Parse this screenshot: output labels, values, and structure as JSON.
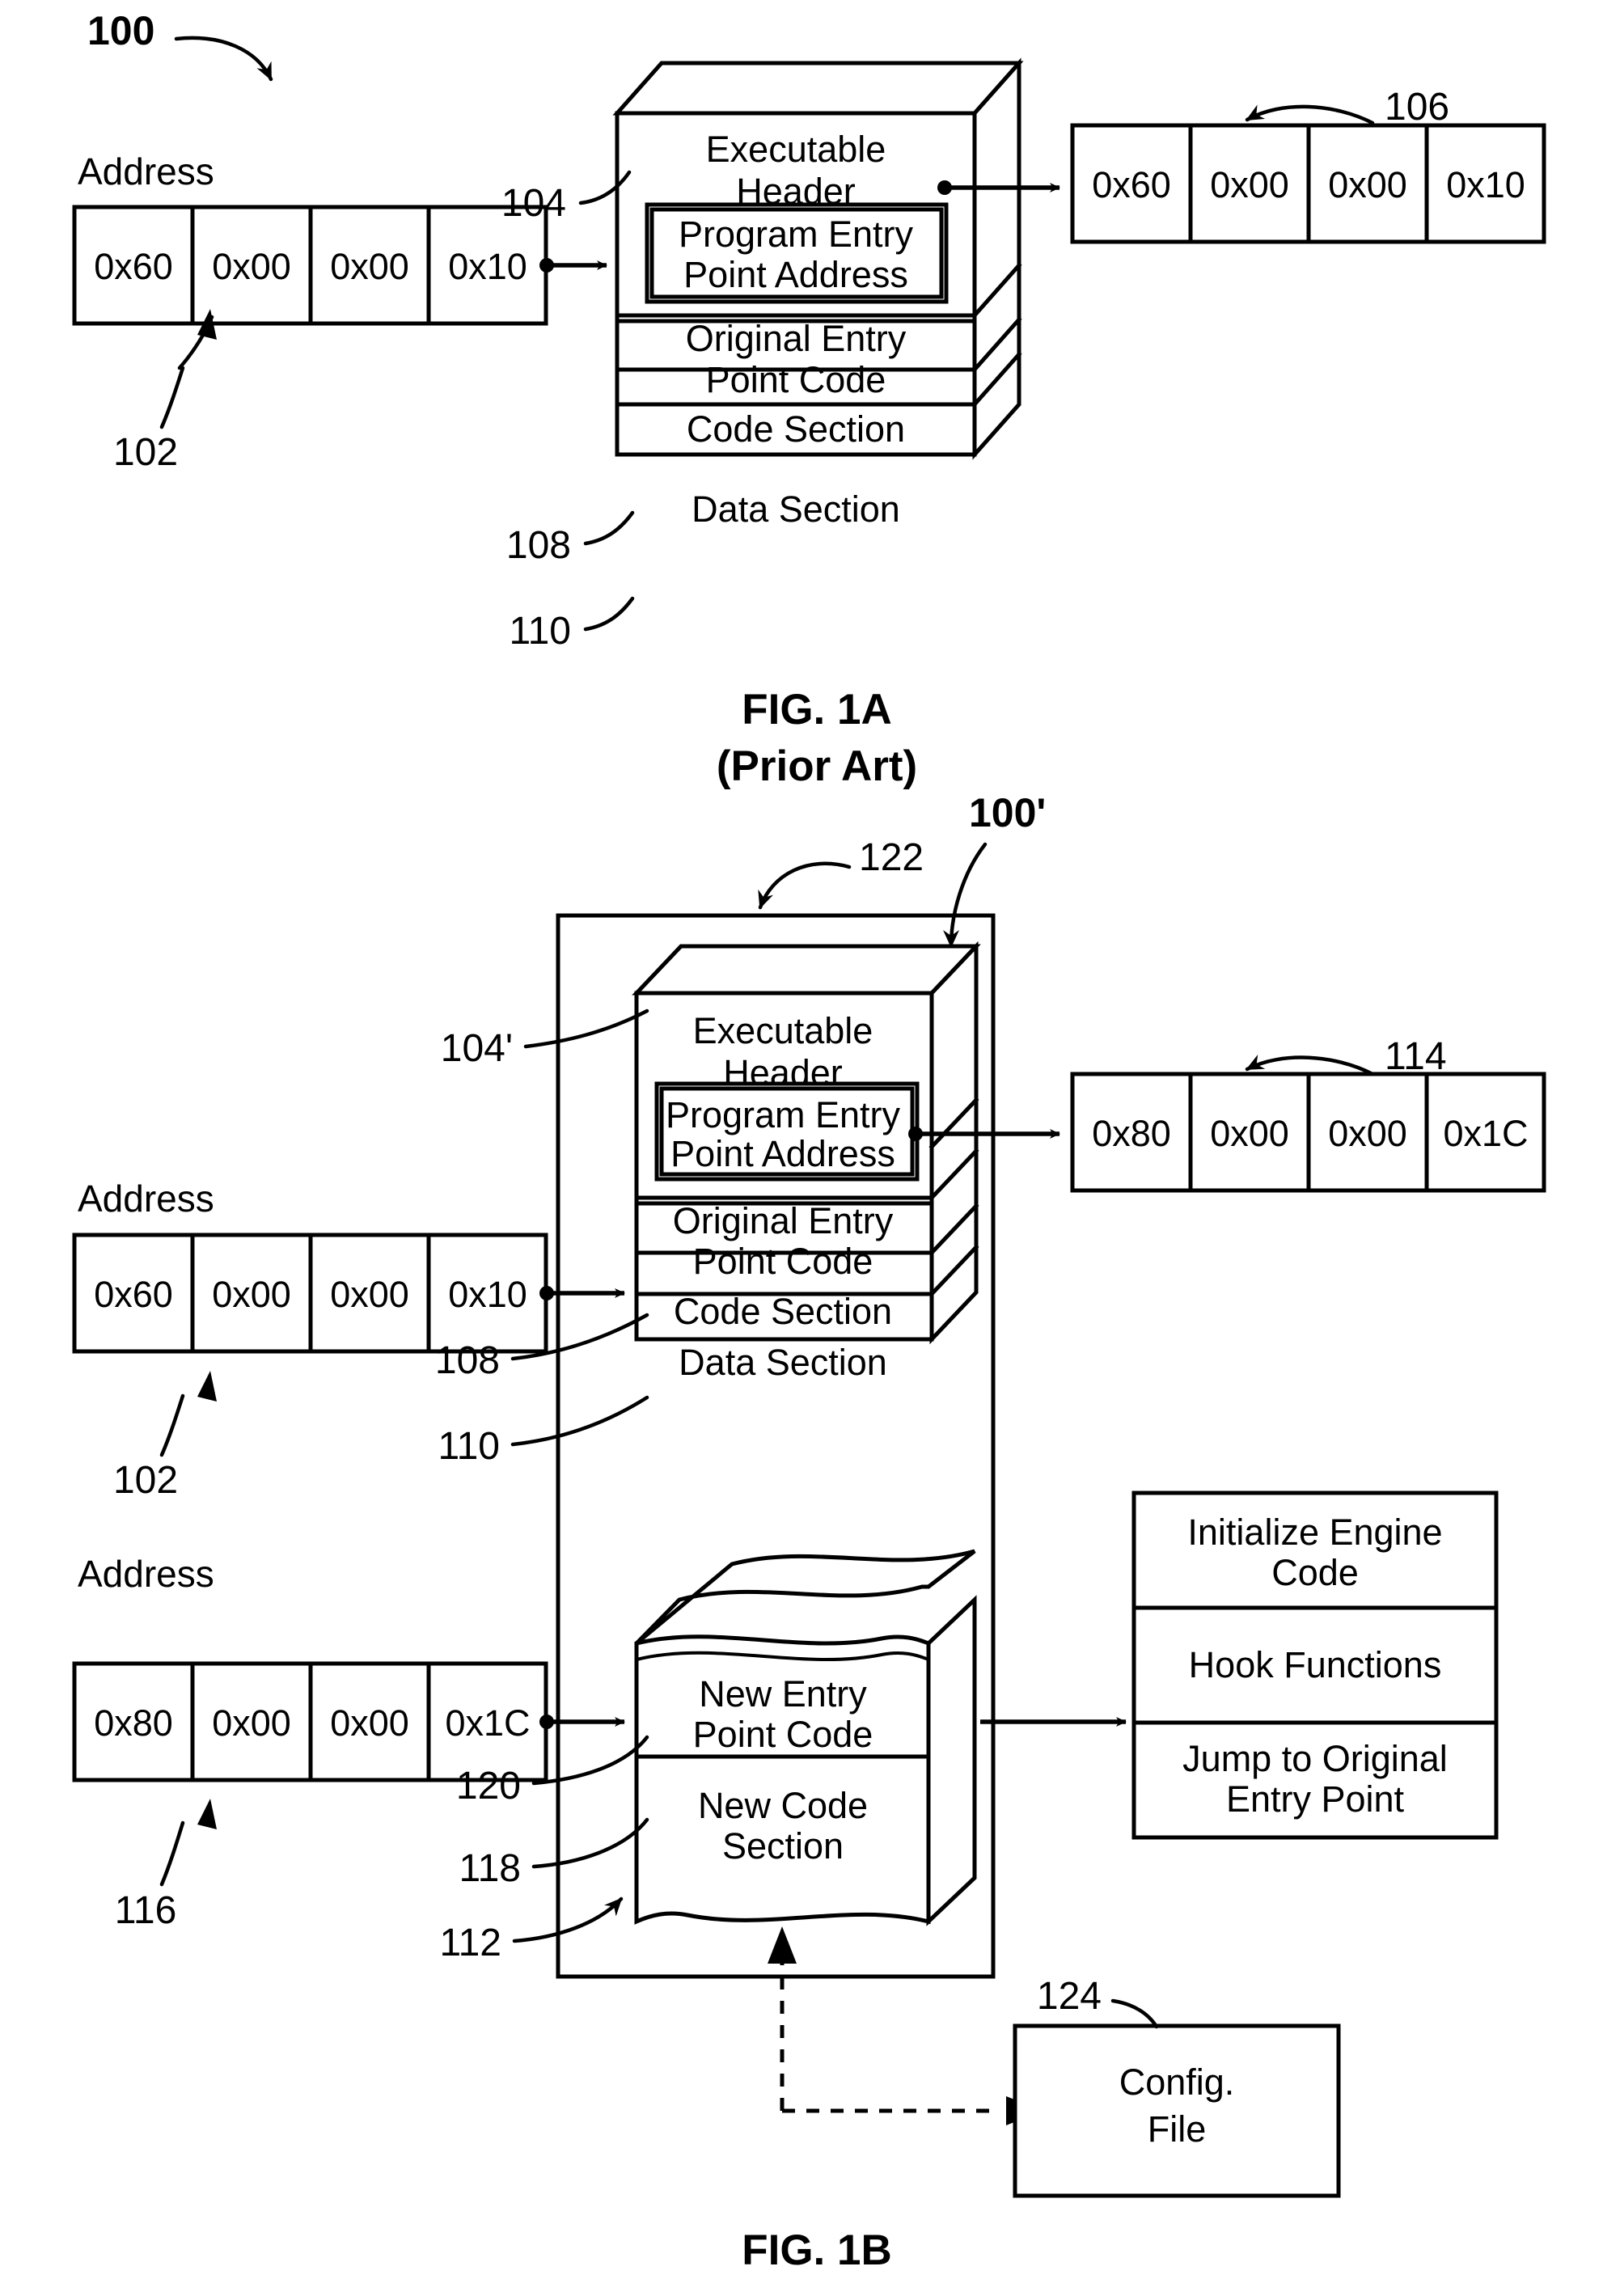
{
  "figures": [
    {
      "id": "fig-1a",
      "caption": "FIG. 1A",
      "subcaption": "(Prior Art)",
      "overall_ref": "100",
      "address_label": "Address",
      "address_table": {
        "ref": "102",
        "cells": [
          "0x60",
          "0x00",
          "0x00",
          "0x10"
        ]
      },
      "executable": {
        "ref": "104",
        "sections": [
          {
            "ref": "104",
            "label": "Executable Header"
          },
          {
            "ref": "",
            "label": "Program Entry Point Address"
          },
          {
            "ref": "",
            "label": "Original Entry Point Code"
          },
          {
            "ref": "108",
            "label": "Code Section"
          },
          {
            "ref": "110",
            "label": "Data Section"
          }
        ]
      },
      "target_table": {
        "ref": "106",
        "cells": [
          "0x60",
          "0x00",
          "0x00",
          "0x10"
        ]
      }
    },
    {
      "id": "fig-1b",
      "caption": "FIG. 1B",
      "subcaption": "",
      "overall_ref": "100'",
      "container_ref": "122",
      "address_label_top": "Address",
      "address_label_bottom": "Address",
      "address_table_top": {
        "ref": "102",
        "cells": [
          "0x60",
          "0x00",
          "0x00",
          "0x10"
        ]
      },
      "address_table_bottom": {
        "ref": "116",
        "cells": [
          "0x80",
          "0x00",
          "0x00",
          "0x1C"
        ]
      },
      "executable": {
        "ref": "104'",
        "sections": [
          {
            "ref": "104'",
            "label": "Executable Header"
          },
          {
            "ref": "",
            "label": "Program Entry Point Address"
          },
          {
            "ref": "",
            "label": "Original Entry Point Code"
          },
          {
            "ref": "108",
            "label": "Code Section"
          },
          {
            "ref": "110",
            "label": "Data Section"
          }
        ]
      },
      "new_block": {
        "ref": "112",
        "sections": [
          {
            "ref": "120",
            "label": "New Entry Point Code"
          },
          {
            "ref": "118",
            "label": "New Code Section"
          }
        ]
      },
      "target_table": {
        "ref": "114",
        "cells": [
          "0x80",
          "0x00",
          "0x00",
          "0x1C"
        ]
      },
      "engine_block": {
        "rows": [
          "Initialize Engine Code",
          "Hook Functions",
          "Jump to Original Entry Point"
        ]
      },
      "config_file": {
        "ref": "124",
        "label": "Config. File"
      }
    }
  ],
  "text": {
    "executable_header_l1": "Executable",
    "executable_header_l2": "Header",
    "program_entry_l1": "Program Entry",
    "program_entry_l2": "Point Address",
    "original_entry_l1": "Original Entry",
    "original_entry_l2": "Point Code",
    "code_section": "Code Section",
    "data_section": "Data Section",
    "new_entry_l1": "New Entry",
    "new_entry_l2": "Point Code",
    "new_code_l1": "New Code",
    "new_code_l2": "Section",
    "init_engine_l1": "Initialize Engine",
    "init_engine_l2": "Code",
    "hook_functions": "Hook Functions",
    "jump_orig_l1": "Jump to Original",
    "jump_orig_l2": "Entry Point",
    "config_l1": "Config.",
    "config_l2": "File",
    "address": "Address",
    "fig1a": "FIG. 1A",
    "fig1a_sub": "(Prior Art)",
    "fig1b": "FIG. 1B",
    "ref_100": "100",
    "ref_100p": "100'",
    "ref_102": "102",
    "ref_104": "104",
    "ref_104p": "104'",
    "ref_106": "106",
    "ref_108": "108",
    "ref_110": "110",
    "ref_112": "112",
    "ref_114": "114",
    "ref_116": "116",
    "ref_118": "118",
    "ref_120": "120",
    "ref_122": "122",
    "ref_124": "124",
    "cell_0x60": "0x60",
    "cell_0x00": "0x00",
    "cell_0x10": "0x10",
    "cell_0x80": "0x80",
    "cell_0x1C": "0x1C"
  },
  "colors": {
    "ink": "#000000",
    "paper": "#ffffff"
  }
}
